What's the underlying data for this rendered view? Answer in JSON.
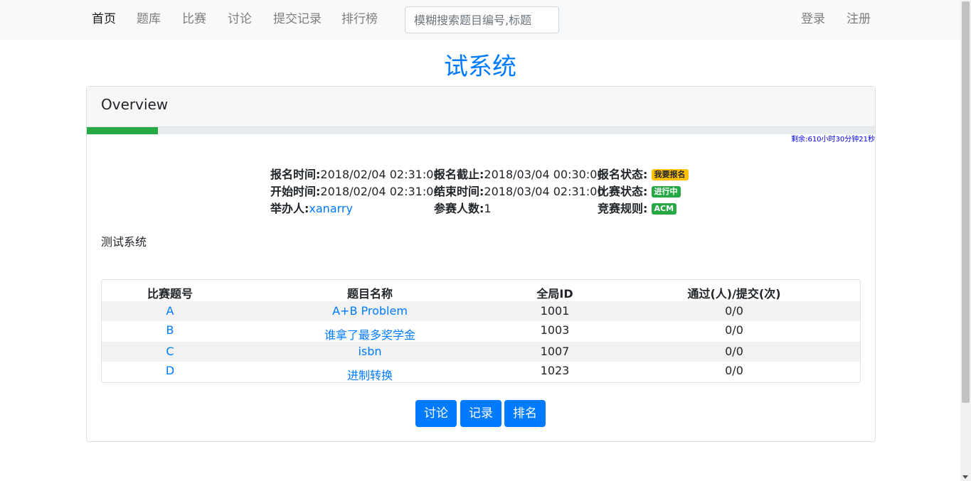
{
  "nav": {
    "items": [
      "首页",
      "题库",
      "比赛",
      "讨论",
      "提交记录",
      "排行榜"
    ],
    "search_placeholder": "模糊搜索题目编号,标题",
    "login": "登录",
    "register": "注册"
  },
  "contest": {
    "title": "试系统",
    "overview": "Overview",
    "progress_percent": 9,
    "remaining": "剩余:610小时30分钟21秒",
    "info": {
      "reg_time_label": "报名时间:",
      "reg_time": "2018/02/04 02:31:00",
      "reg_end_label": "报名截止:",
      "reg_end": "2018/03/04 00:30:00",
      "reg_status_label": "报名状态:",
      "reg_status": "我要报名",
      "start_label": "开始时间:",
      "start": "2018/02/04 02:31:00",
      "end_label": "结束时间:",
      "end": "2018/03/04 02:31:00",
      "status_label": "比赛状态:",
      "status": "进行中",
      "host_label": "举办人:",
      "host": "xanarry",
      "participants_label": "参赛人数:",
      "participants": "1",
      "rule_label": "竞赛规则:",
      "rule": "ACM"
    },
    "description": "测试系统",
    "table": {
      "headers": [
        "比赛题号",
        "题目名称",
        "全局ID",
        "通过(人)/提交(次)"
      ],
      "rows": [
        {
          "no": "A",
          "name": "A+B Problem",
          "id": "1001",
          "stat": "0/0"
        },
        {
          "no": "B",
          "name": "谁拿了最多奖学金",
          "id": "1003",
          "stat": "0/0"
        },
        {
          "no": "C",
          "name": "isbn",
          "id": "1007",
          "stat": "0/0"
        },
        {
          "no": "D",
          "name": "进制转换",
          "id": "1023",
          "stat": "0/0"
        }
      ]
    },
    "buttons": [
      "讨论",
      "记录",
      "排名"
    ]
  }
}
